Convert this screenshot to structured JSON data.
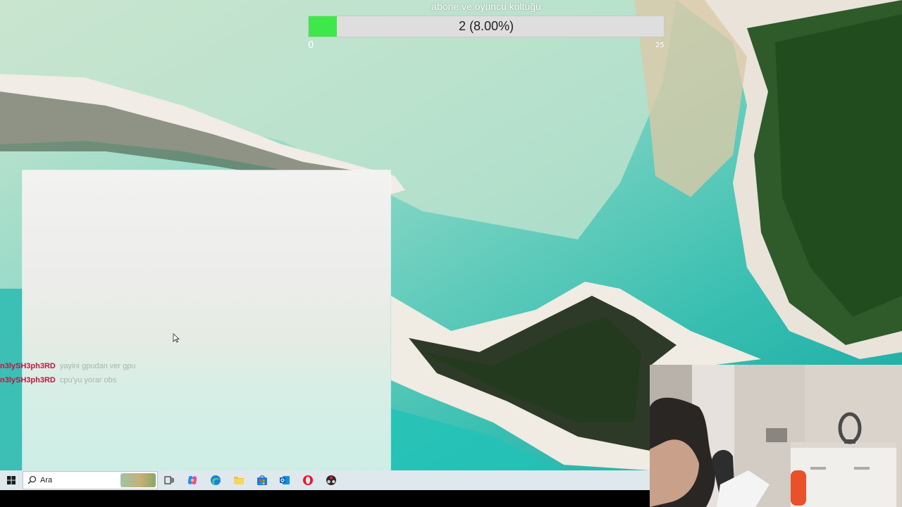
{
  "goal": {
    "title": "abone ve oyuncu koltuğu",
    "progress_text": "2 (8.00%)",
    "current": 2,
    "target": 25,
    "progress_fraction": 0.08,
    "min_label": "0",
    "max_label": "25",
    "fill_color": "#3ee84b"
  },
  "chat": [
    {
      "user": "n3lySH3ph3RD",
      "message": "yayini gpudan ver gpu"
    },
    {
      "user": "n3lySH3ph3RD",
      "message": "cpu'yu yorar obs"
    }
  ],
  "taskbar": {
    "search_value": "Ara",
    "icons": [
      "windows-start-icon",
      "search-icon",
      "task-view-icon",
      "copilot-icon",
      "edge-icon",
      "file-explorer-icon",
      "store-icon",
      "outlook-icon",
      "opera-icon",
      "obs-icon"
    ]
  },
  "colors": {
    "chat_user": "#c4123f",
    "taskbar": "#dfe8ec"
  }
}
